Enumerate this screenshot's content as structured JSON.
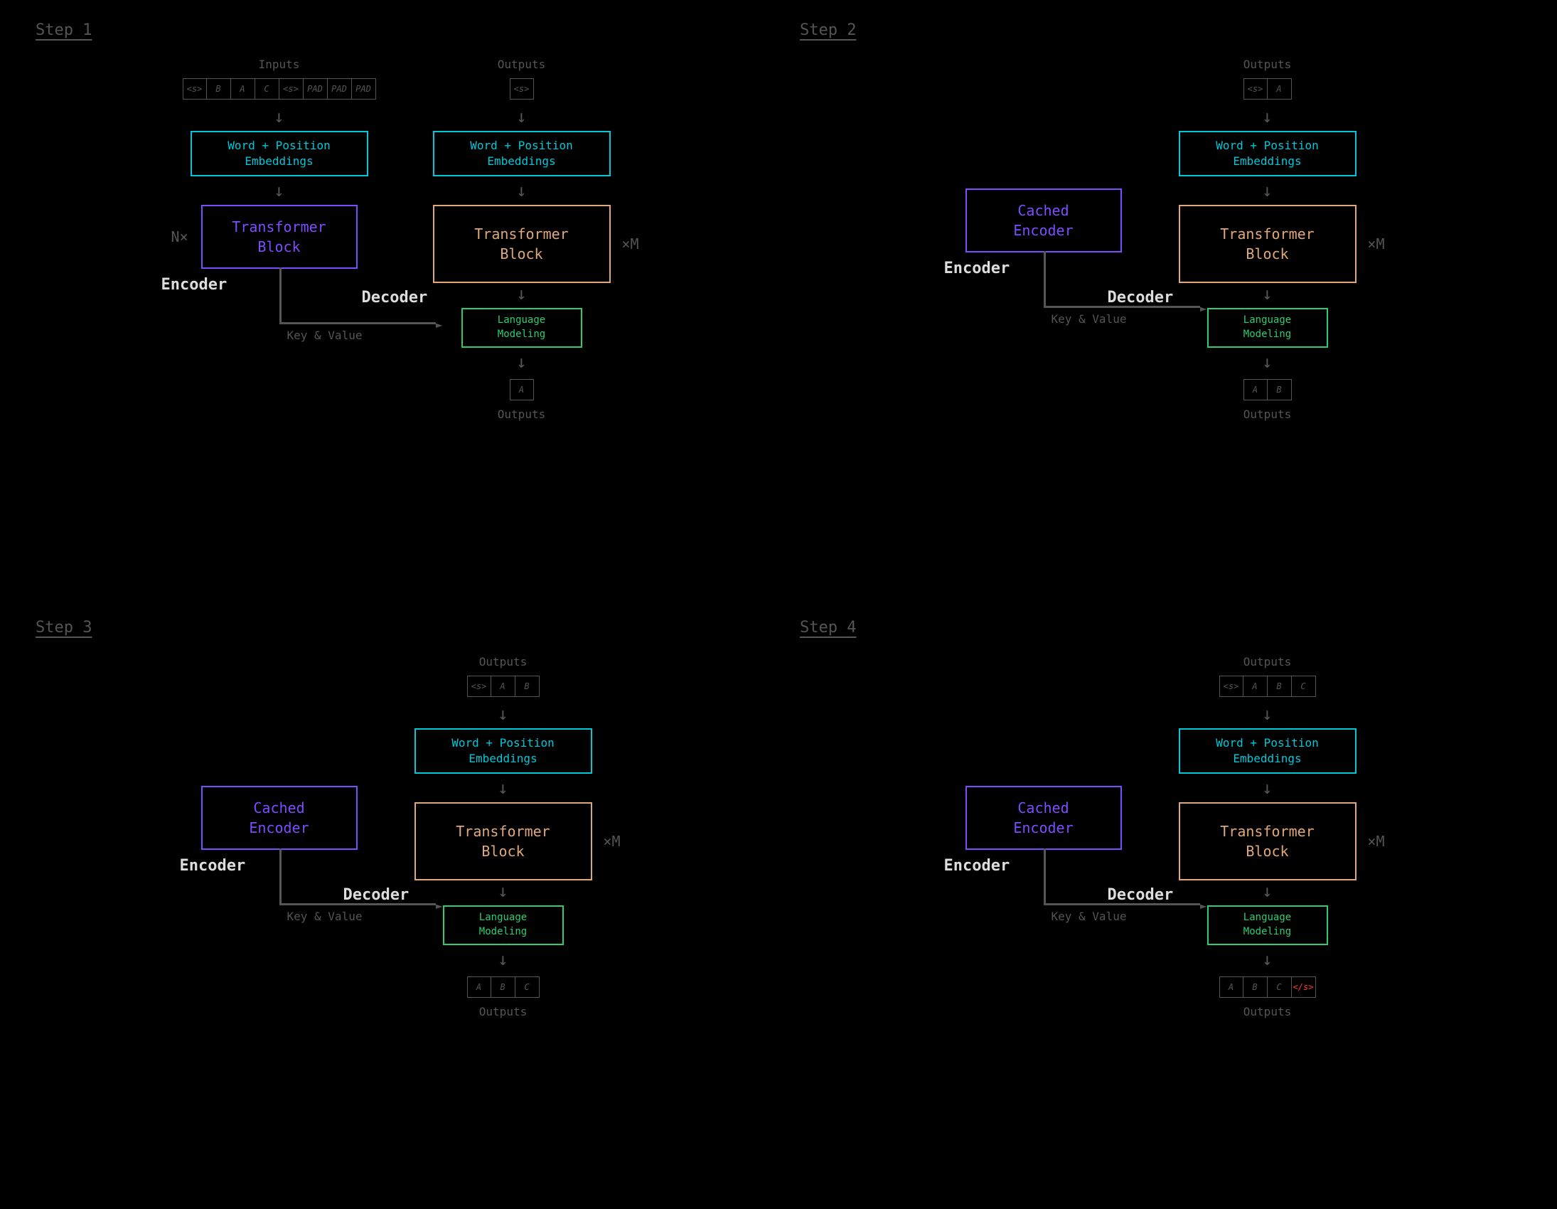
{
  "labels": {
    "inputs": "Inputs",
    "outputs": "Outputs",
    "embeddings": "Word + Position Embeddings",
    "transformer_block": "Transformer Block",
    "cached_encoder": "Cached Encoder",
    "language_modeling": "Language Modeling",
    "encoder": "Encoder",
    "decoder": "Decoder",
    "key_value": "Key & Value",
    "n_times": "N×",
    "m_times": "×M"
  },
  "steps": [
    {
      "title": "Step 1",
      "encoder": {
        "has_inputs": true,
        "input_tokens": [
          "<s>",
          "B",
          "A",
          "C",
          "<s>",
          "PAD",
          "PAD",
          "PAD"
        ],
        "box_label_key": "transformer_block",
        "show_n": true
      },
      "decoder": {
        "output_tokens_in": [
          "<s>"
        ],
        "output_tokens_out": [
          "A"
        ]
      }
    },
    {
      "title": "Step 2",
      "encoder": {
        "has_inputs": false,
        "box_label_key": "cached_encoder",
        "show_n": false
      },
      "decoder": {
        "output_tokens_in": [
          "<s>",
          "A"
        ],
        "output_tokens_out": [
          "A",
          "B"
        ]
      }
    },
    {
      "title": "Step 3",
      "encoder": {
        "has_inputs": false,
        "box_label_key": "cached_encoder",
        "show_n": false
      },
      "decoder": {
        "output_tokens_in": [
          "<s>",
          "A",
          "B"
        ],
        "output_tokens_out": [
          "A",
          "B",
          "C"
        ]
      }
    },
    {
      "title": "Step 4",
      "encoder": {
        "has_inputs": false,
        "box_label_key": "cached_encoder",
        "show_n": false
      },
      "decoder": {
        "output_tokens_in": [
          "<s>",
          "A",
          "B",
          "C"
        ],
        "output_tokens_out": [
          "A",
          "B",
          "C",
          "</s>"
        ],
        "output_red_indices": [
          3
        ]
      }
    }
  ]
}
